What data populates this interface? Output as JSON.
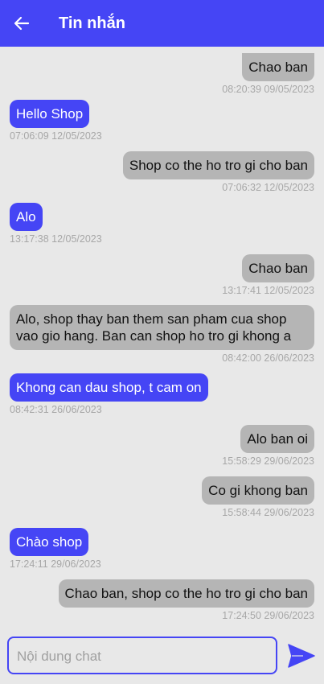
{
  "header": {
    "title": "Tin nhắn",
    "back_icon": "arrow-left-icon",
    "background": "#4545f5"
  },
  "messages": [
    {
      "side": "right",
      "text": "Chao ban",
      "time": "08:20:39 09/05/2023"
    },
    {
      "side": "left",
      "text": "Hello Shop",
      "time": "07:06:09 12/05/2023"
    },
    {
      "side": "right",
      "text": "Shop co the ho tro gi cho ban",
      "time": "07:06:32 12/05/2023"
    },
    {
      "side": "left",
      "text": "Alo",
      "time": "13:17:38 12/05/2023"
    },
    {
      "side": "right",
      "text": "Chao ban",
      "time": "13:17:41 12/05/2023"
    },
    {
      "side": "right",
      "text": "Alo, shop thay ban them san pham cua shop vao gio hang. Ban can shop ho tro gi khong a",
      "time": "08:42:00 26/06/2023"
    },
    {
      "side": "left",
      "text": "Khong can dau shop, t cam on",
      "time": "08:42:31 26/06/2023"
    },
    {
      "side": "right",
      "text": "Alo ban oi",
      "time": "15:58:29 29/06/2023"
    },
    {
      "side": "right",
      "text": "Co gi khong ban",
      "time": "15:58:44 29/06/2023"
    },
    {
      "side": "left",
      "text": "Chào shop",
      "time": "17:24:11 29/06/2023"
    },
    {
      "side": "right",
      "text": "Chao ban, shop co the ho tro gi cho ban",
      "time": "17:24:50 29/06/2023"
    }
  ],
  "composer": {
    "placeholder": "Nội dung chat",
    "value": "",
    "send_icon": "send-icon"
  },
  "colors": {
    "accent": "#4545f5",
    "incoming_bubble": "#4545f5",
    "outgoing_bubble": "#b5b5b5",
    "background": "#e8e8e8",
    "timestamp": "#a7a7a7"
  }
}
